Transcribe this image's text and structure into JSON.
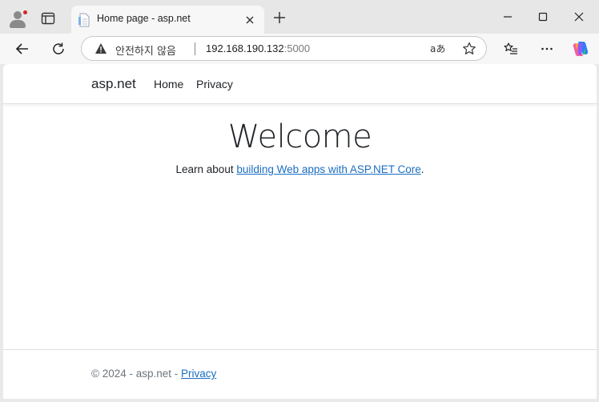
{
  "browser": {
    "tab_title": "Home page - asp.net",
    "security_text": "안전하지 않음",
    "url_host": "192.168.190.132",
    "url_port": ":5000",
    "read_aloud_glyph": "aあ"
  },
  "site": {
    "brand": "asp.net",
    "nav": [
      {
        "label": "Home"
      },
      {
        "label": "Privacy"
      }
    ],
    "heading": "Welcome",
    "learn_prefix": "Learn about ",
    "learn_link": "building Web apps with ASP.NET Core",
    "learn_suffix": ".",
    "footer_text": "© 2024 - asp.net - ",
    "footer_link": "Privacy"
  },
  "colors": {
    "link": "#1b6ec2",
    "text": "#212529",
    "footer_text": "#6c757d",
    "warning_icon": "#3b3b3b"
  }
}
